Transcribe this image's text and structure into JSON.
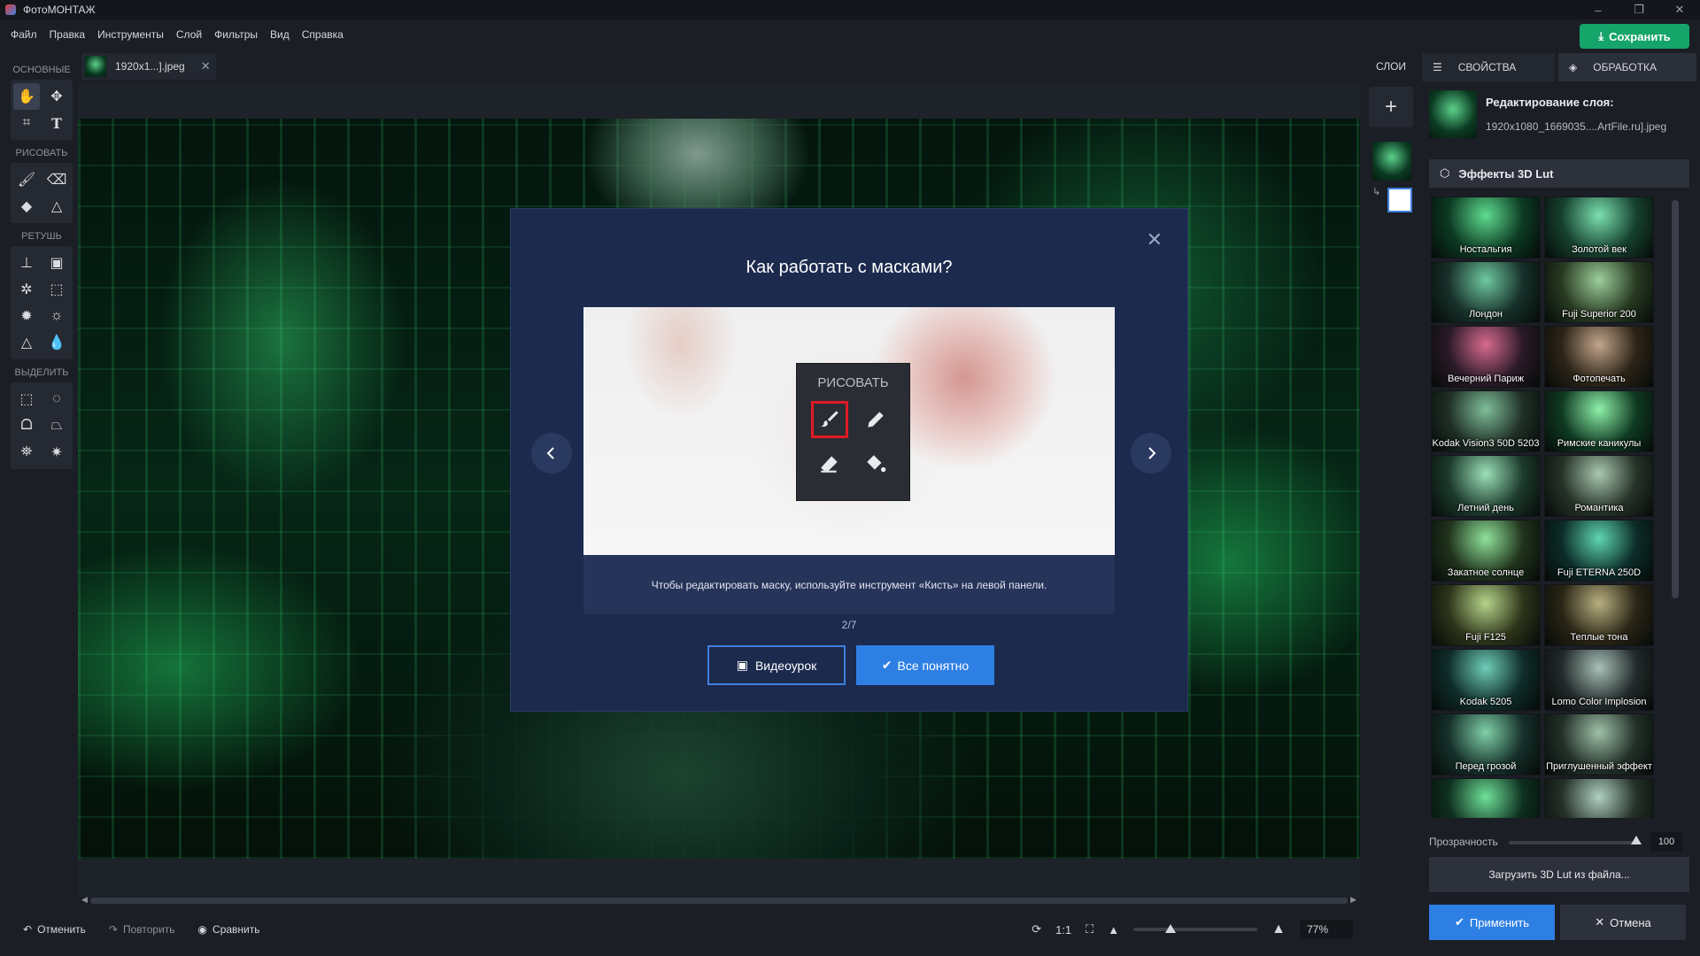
{
  "app": {
    "title": "ФотоМОНТАЖ"
  },
  "menu": [
    "Файл",
    "Правка",
    "Инструменты",
    "Слой",
    "Фильтры",
    "Вид",
    "Справка"
  ],
  "save_label": "Сохранить",
  "tools": {
    "sections": [
      "ОСНОВНЫЕ",
      "РИСОВАТЬ",
      "РЕТУШЬ",
      "ВЫДЕЛИТЬ"
    ]
  },
  "doc_tab": {
    "name": "1920x1...].jpeg"
  },
  "modal": {
    "title": "Как работать с масками?",
    "panel_label": "РИСОВАТЬ",
    "caption": "Чтобы редактировать маску, используйте инструмент «Кисть» на левой панели.",
    "counter": "2/7",
    "video_label": "Видеоурок",
    "ok_label": "Все понятно"
  },
  "layers": {
    "header": "СЛОИ"
  },
  "right_panel": {
    "tab_properties": "СВОЙСТВА",
    "tab_processing": "ОБРАБОТКА",
    "layer_title": "Редактирование слоя:",
    "layer_file": "1920x1080_1669035....ArtFile.ru].jpeg",
    "lut_header": "Эффекты 3D Lut",
    "luts": [
      "Ностальгия",
      "Золотой век",
      "Лондон",
      "Fuji Superior 200",
      "Вечерний Париж",
      "Фотопечать",
      "Kodak Vision3 50D 5203",
      "Римские каникулы",
      "Летний день",
      "Романтика",
      "Закатное солнце",
      "Fuji ETERNA 250D",
      "Fuji F125",
      "Теплые тона",
      "Kodak 5205",
      "Lomo Color Implosion",
      "Перед грозой",
      "Приглушенный эффект",
      "",
      ""
    ],
    "opacity_label": "Прозрачность",
    "opacity_value": "100",
    "load_lut": "Загрузить 3D Lut из файла...",
    "apply": "Применить",
    "cancel": "Отмена"
  },
  "bottom": {
    "undo": "Отменить",
    "redo": "Повторить",
    "compare": "Сравнить",
    "ratio": "1:1",
    "zoom": "77%"
  }
}
